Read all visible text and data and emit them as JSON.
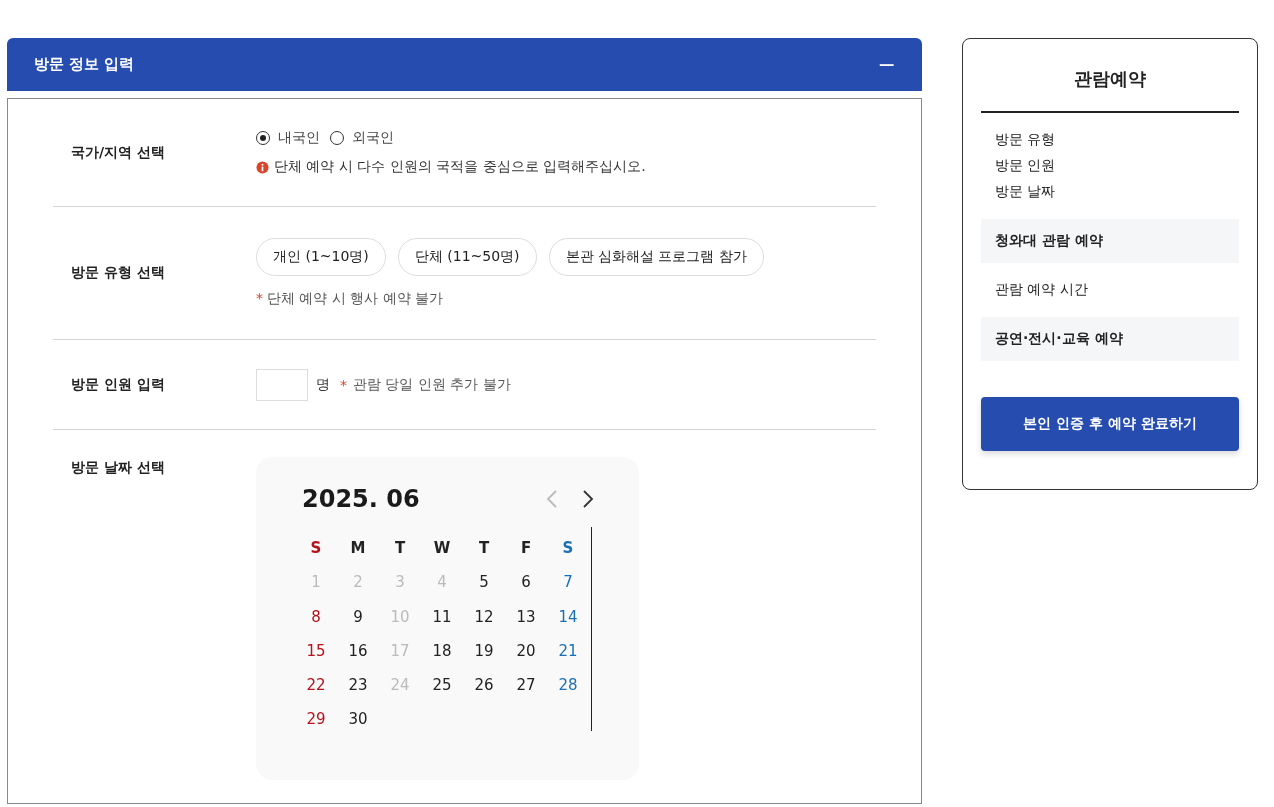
{
  "panel": {
    "title": "방문 정보 입력",
    "collapse_icon": "−"
  },
  "nationality": {
    "label": "국가/지역 선택",
    "options": [
      {
        "label": "내국인",
        "selected": true
      },
      {
        "label": "외국인",
        "selected": false
      }
    ],
    "notice": "단체 예약 시 다수 인원의 국적을 중심으로 입력해주십시오."
  },
  "visit_type": {
    "label": "방문 유형 선택",
    "options": [
      {
        "label": "개인 (1~10명)",
        "selected": false
      },
      {
        "label": "단체 (11~50명)",
        "selected": false
      },
      {
        "label": "본관 심화해설 프로그램 참가",
        "selected": false
      }
    ],
    "note_mark": "*",
    "note": "단체 예약 시 행사 예약 불가"
  },
  "visitors": {
    "label": "방문 인원 입력",
    "unit": "명",
    "note_mark": "*",
    "note": "관람 당일 인원 추가 불가"
  },
  "visit_date": {
    "label": "방문 날짜 선택",
    "calendar": {
      "month": "2025. 06",
      "prev_disabled": true,
      "next_disabled": false,
      "weekdays": [
        {
          "label": "S",
          "kind": "sunday"
        },
        {
          "label": "M",
          "kind": "weekday"
        },
        {
          "label": "T",
          "kind": "weekday"
        },
        {
          "label": "W",
          "kind": "weekday"
        },
        {
          "label": "T",
          "kind": "weekday"
        },
        {
          "label": "F",
          "kind": "weekday"
        },
        {
          "label": "S",
          "kind": "saturday"
        }
      ],
      "days": [
        {
          "day": "1",
          "disabled": true
        },
        {
          "day": "2",
          "disabled": true
        },
        {
          "day": "3",
          "disabled": true
        },
        {
          "day": "4",
          "disabled": true
        },
        {
          "day": "5",
          "disabled": false
        },
        {
          "day": "6",
          "disabled": false
        },
        {
          "day": "7",
          "disabled": false
        },
        {
          "day": "8",
          "disabled": false
        },
        {
          "day": "9",
          "disabled": false
        },
        {
          "day": "10",
          "disabled": true
        },
        {
          "day": "11",
          "disabled": false
        },
        {
          "day": "12",
          "disabled": false
        },
        {
          "day": "13",
          "disabled": false
        },
        {
          "day": "14",
          "disabled": false
        },
        {
          "day": "15",
          "disabled": false
        },
        {
          "day": "16",
          "disabled": false
        },
        {
          "day": "17",
          "disabled": true
        },
        {
          "day": "18",
          "disabled": false
        },
        {
          "day": "19",
          "disabled": false
        },
        {
          "day": "20",
          "disabled": false
        },
        {
          "day": "21",
          "disabled": false
        },
        {
          "day": "22",
          "disabled": false
        },
        {
          "day": "23",
          "disabled": false
        },
        {
          "day": "24",
          "disabled": true
        },
        {
          "day": "25",
          "disabled": false
        },
        {
          "day": "26",
          "disabled": false
        },
        {
          "day": "27",
          "disabled": false
        },
        {
          "day": "28",
          "disabled": false
        },
        {
          "day": "29",
          "disabled": false
        },
        {
          "day": "30",
          "disabled": false
        }
      ]
    }
  },
  "summary": {
    "title": "관람예약",
    "items": [
      {
        "label": "방문 유형",
        "kind": "plain"
      },
      {
        "label": "방문 인원",
        "kind": "plain"
      },
      {
        "label": "방문 날짜",
        "kind": "plain"
      },
      {
        "label": "청와대 관람 예약",
        "kind": "section"
      },
      {
        "label": "관람 예약 시간",
        "kind": "plain"
      },
      {
        "label": "공연·전시·교육 예약",
        "kind": "section"
      }
    ],
    "submit": "본인 인증 후 예약 완료하기"
  }
}
